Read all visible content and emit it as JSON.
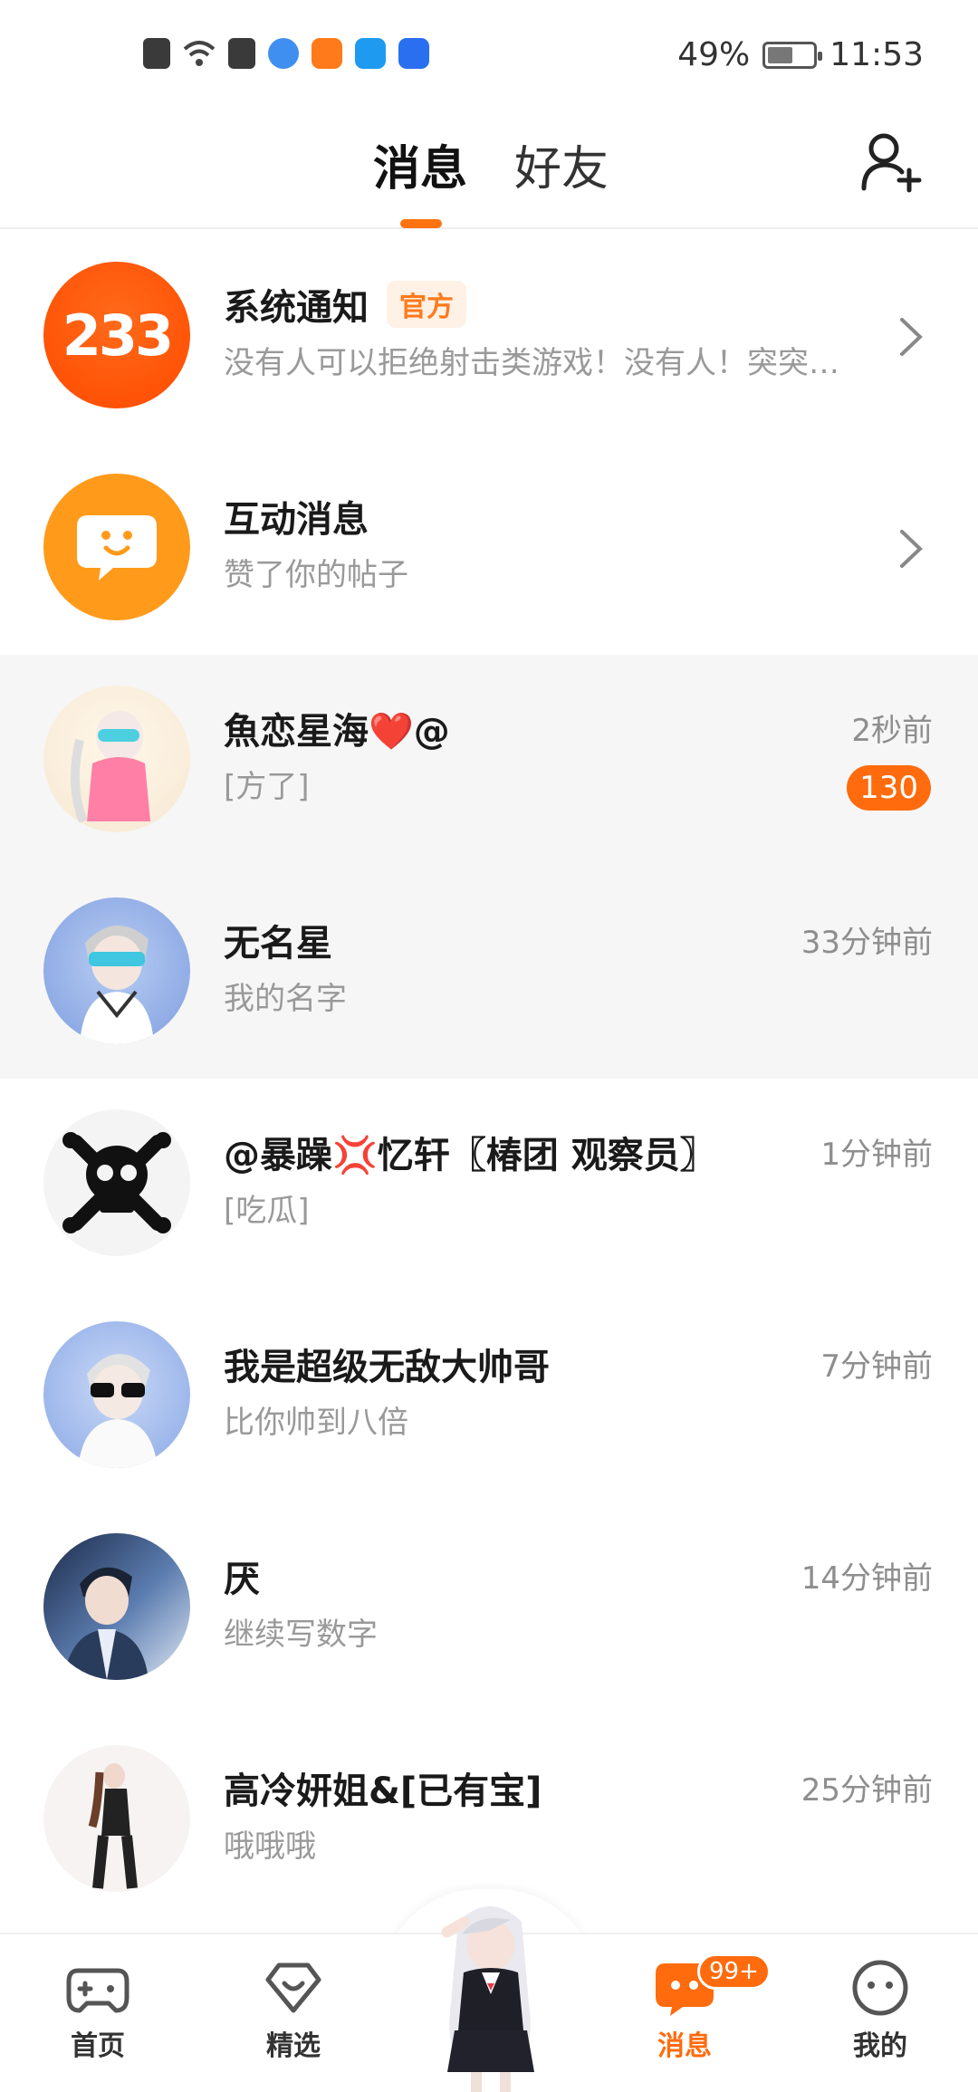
{
  "status_bar": {
    "battery": "49%",
    "time": "11:53"
  },
  "header": {
    "tabs": [
      {
        "label": "消息",
        "active": true
      },
      {
        "label": "好友",
        "active": false
      }
    ]
  },
  "system_rows": [
    {
      "title": "系统通知",
      "badge": "官方",
      "subtitle": "没有人可以拒绝射击类游戏！没有人！突突…",
      "avatar_text": "233"
    },
    {
      "title": "互动消息",
      "subtitle": "赞了你的帖子"
    }
  ],
  "conversations": [
    {
      "name": "魚恋星海❤️@",
      "preview": "[方了]",
      "time": "2秒前",
      "unread": "130",
      "highlight": true
    },
    {
      "name": "无名星",
      "preview": "我的名字",
      "time": "33分钟前",
      "highlight": true
    },
    {
      "name": "@暴躁💢忆轩〖椿团 观察员〗",
      "preview": "[吃瓜]",
      "time": "1分钟前"
    },
    {
      "name": "我是超级无敌大帅哥",
      "preview": "比你帅到八倍",
      "time": "7分钟前"
    },
    {
      "name": "厌",
      "preview": "继续写数字",
      "time": "14分钟前"
    },
    {
      "name": "高冷妍姐&[已有宝]",
      "preview": "哦哦哦",
      "time": "25分钟前"
    }
  ],
  "bottom_nav": {
    "items": [
      {
        "label": "首页",
        "icon": "gamepad-icon"
      },
      {
        "label": "精选",
        "icon": "heart-diamond-icon"
      },
      {
        "label": "消息",
        "icon": "chat-bubble-icon",
        "active": true,
        "badge": "99+"
      },
      {
        "label": "我的",
        "icon": "face-icon"
      }
    ]
  },
  "colors": {
    "accent": "#ff6b0d",
    "highlight_row": "#f6f6f6",
    "muted_text": "#999999"
  }
}
